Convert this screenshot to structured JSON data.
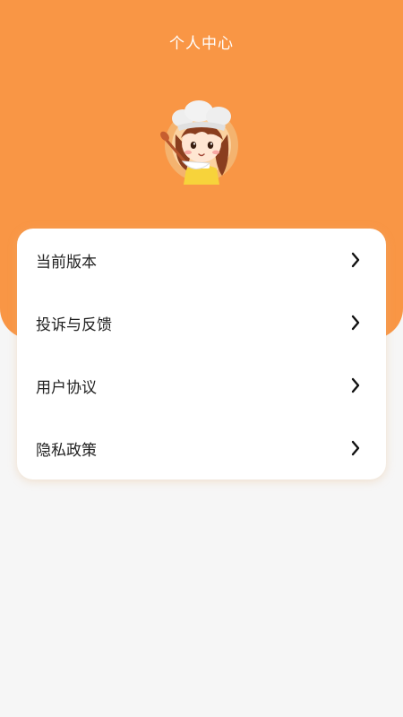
{
  "header": {
    "title": "个人中心",
    "background_color": "#F99645"
  },
  "avatar": {
    "icon": "chef-girl-avatar"
  },
  "menu": {
    "items": [
      {
        "label": "当前版本",
        "icon": "chevron-right-icon"
      },
      {
        "label": "投诉与反馈",
        "icon": "chevron-right-icon"
      },
      {
        "label": "用户协议",
        "icon": "chevron-right-icon"
      },
      {
        "label": "隐私政策",
        "icon": "chevron-right-icon"
      }
    ]
  }
}
